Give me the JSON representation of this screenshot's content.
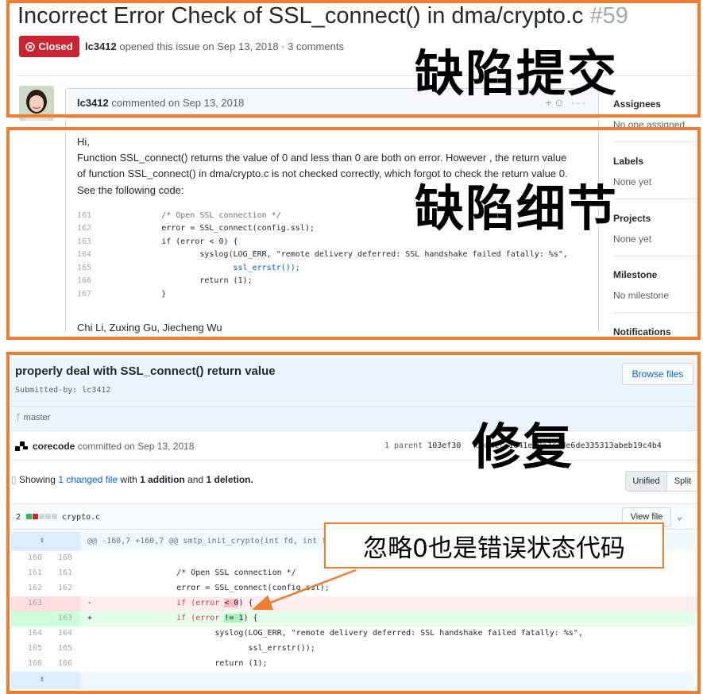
{
  "issue": {
    "title": "Incorrect Error Check of SSL_connect() in dma/crypto.c",
    "number": "#59",
    "status": "Closed",
    "author": "lc3412",
    "meta_text": "opened this issue on Sep 13, 2018 · 3 comments"
  },
  "comment": {
    "author": "lc3412",
    "meta_text": "commented on Sep 13, 2018",
    "greeting": "Hi,",
    "para_line1": "Function SSL_connect() returns the value of 0 and less than 0 are both on error. However , the return value",
    "para_line2": "of function SSL_connect() in dma/crypto.c is not checked correctly, which forgot to check the return value 0.",
    "see_code": "See the following code:",
    "code_lines": [
      {
        "ln": "161",
        "text": "          /* Open SSL connection */"
      },
      {
        "ln": "162",
        "text": "          error = SSL_connect(config.ssl);"
      },
      {
        "ln": "163",
        "text": "          if (error < 0) {"
      },
      {
        "ln": "164",
        "text": "                  syslog(LOG_ERR, \"remote delivery deferred: SSL handshake failed fatally: %s\","
      },
      {
        "ln": "165",
        "text": "                         ssl_errstr());"
      },
      {
        "ln": "166",
        "text": "                  return (1);"
      },
      {
        "ln": "167",
        "text": "          }"
      }
    ],
    "signature": "Chi Li, Zuxing Gu, Jiecheng Wu"
  },
  "sidebar": {
    "assignees_label": "Assignees",
    "assignees_value": "No one assigned",
    "labels_label": "Labels",
    "labels_value": "None yet",
    "projects_label": "Projects",
    "projects_value": "None yet",
    "milestone_label": "Milestone",
    "milestone_value": "No milestone",
    "notifications_label": "Notifications"
  },
  "commit": {
    "title": "properly deal with SSL_connect() return value",
    "submitted_by": "Submitted-by: lc3412",
    "browse_files": "Browse files",
    "branch": "master",
    "committer": "corecode",
    "committed_text": "committed on Sep 13, 2018",
    "parent_text": "1 parent",
    "parent_sha": "103ef30",
    "commit_label": "commit",
    "commit_sha_part1": "1e41e00",
    "commit_sha_part2": "e3cdde6de335313abeb19c4b4"
  },
  "diff_summary": {
    "showing": "Showing",
    "changed": "1 changed file",
    "with": "with",
    "additions": "1 addition",
    "and": "and",
    "deletions": "1 deletion."
  },
  "view_toggle": {
    "unified": "Unified",
    "split": "Split"
  },
  "file": {
    "change_count": "2",
    "name": "crypto.c",
    "view_file": "View file"
  },
  "diff": {
    "hunk_header": "@@ -160,7 +160,7 @@ smtp_init_crypto(int fd, int feature)",
    "rows": [
      {
        "type": "ctx",
        "old": "160",
        "new": "160",
        "sign": "",
        "pre": "",
        "hl": "",
        "post": ""
      },
      {
        "type": "ctx",
        "old": "161",
        "new": "161",
        "sign": "",
        "pre": "        /* Open SSL connection */",
        "hl": "",
        "post": ""
      },
      {
        "type": "ctx",
        "old": "162",
        "new": "162",
        "sign": "",
        "pre": "        error = SSL_connect(config.ssl);",
        "hl": "",
        "post": ""
      },
      {
        "type": "del",
        "old": "163",
        "new": "",
        "sign": "-",
        "pre": "        if (error ",
        "hl": "< 0",
        "post": ") {"
      },
      {
        "type": "add",
        "old": "",
        "new": "163",
        "sign": "+",
        "pre": "        if (error ",
        "hl": "!= 1",
        "post": ") {"
      },
      {
        "type": "ctx",
        "old": "164",
        "new": "164",
        "sign": "",
        "pre": "                syslog(LOG_ERR, \"remote delivery deferred: SSL handshake failed fatally: %s\",",
        "hl": "",
        "post": ""
      },
      {
        "type": "ctx",
        "old": "165",
        "new": "165",
        "sign": "",
        "pre": "                       ssl_errstr());",
        "hl": "",
        "post": ""
      },
      {
        "type": "ctx",
        "old": "166",
        "new": "166",
        "sign": "",
        "pre": "                return (1);",
        "hl": "",
        "post": ""
      }
    ]
  },
  "annotations": {
    "defect_submission": "缺陷提交",
    "defect_details": "缺陷细节",
    "fix": "修复",
    "callout": "忽略0也是错误状态代码"
  },
  "colors": {
    "annotation_border": "#ed7d31",
    "closed_red": "#cb2431",
    "link_blue": "#0366d6"
  }
}
